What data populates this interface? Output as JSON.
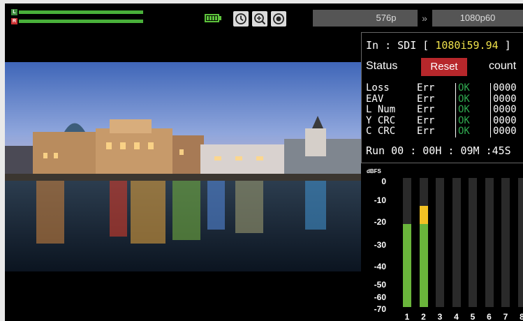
{
  "audio_levels": {
    "left_label": "L",
    "right_label": "R",
    "left_level": 1.0,
    "right_level": 1.0,
    "color": "#49b03a"
  },
  "status_icons": [
    "battery-icon",
    "clock-icon",
    "zoom-icon",
    "record-icon"
  ],
  "battery_cells": 4,
  "format": {
    "input": "576p",
    "output": "1080p60",
    "arrow": "»"
  },
  "sdi": {
    "in_prefix": "In : SDI [",
    "in_format": "1080i59.94",
    "in_suffix": "]",
    "status_label": "Status",
    "reset_label": "Reset",
    "count_label": "count",
    "rows": [
      {
        "name": "Loss",
        "err": "Err",
        "ok": "OK",
        "count": "0000"
      },
      {
        "name": "EAV",
        "err": "Err",
        "ok": "OK",
        "count": "0000"
      },
      {
        "name": "L Num",
        "err": "Err",
        "ok": "OK",
        "count": "0000"
      },
      {
        "name": "Y CRC",
        "err": "Err",
        "ok": "OK",
        "count": "0000"
      },
      {
        "name": "C CRC",
        "err": "Err",
        "ok": "OK",
        "count": "0000"
      }
    ],
    "run_time": "Run 00 : 00H : 09M :45S",
    "colors": {
      "format": "#f0e24b",
      "reset": "#b7272b",
      "ok": "#2fa84f"
    }
  },
  "meter": {
    "unit": "dBFS",
    "scale": [
      "0",
      "-10",
      "-20",
      "-30",
      "-40",
      "-50",
      "-60",
      "-70"
    ],
    "channels": [
      {
        "label": "1",
        "level_db": -25,
        "peak_db": null
      },
      {
        "label": "2",
        "level_db": -25,
        "peak_db": -15
      },
      {
        "label": "3",
        "level_db": null,
        "peak_db": null
      },
      {
        "label": "4",
        "level_db": null,
        "peak_db": null
      },
      {
        "label": "5",
        "level_db": null,
        "peak_db": null
      },
      {
        "label": "6",
        "level_db": null,
        "peak_db": null
      },
      {
        "label": "7",
        "level_db": null,
        "peak_db": null
      },
      {
        "label": "8",
        "level_db": null,
        "peak_db": null
      }
    ],
    "colors": {
      "level": "#6ab53b",
      "peak": "#f2c224"
    }
  }
}
